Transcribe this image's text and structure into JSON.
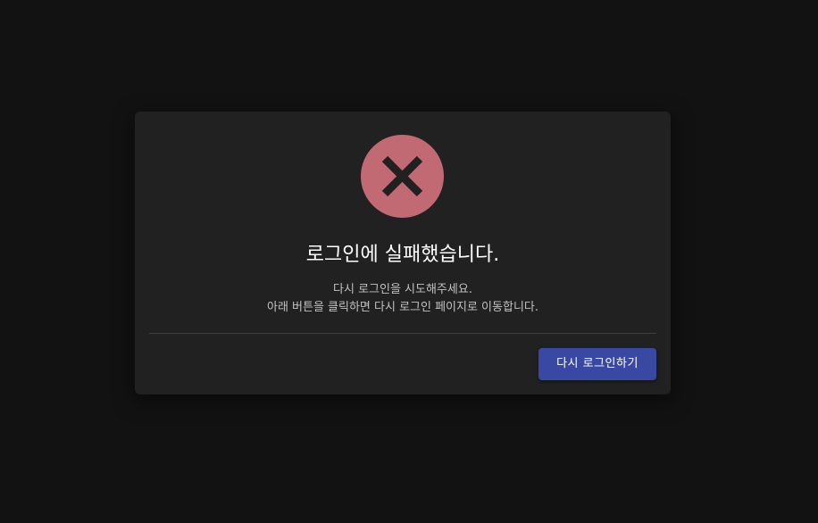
{
  "dialog": {
    "icon": "error-x-icon",
    "title": "로그인에 실패했습니다.",
    "message_lines": [
      "다시 로그인을 시도해주세요.",
      "아래 버튼을 클릭하면 다시 로그인 페이지로 이동합니다."
    ],
    "button_label": "다시 로그인하기"
  },
  "colors": {
    "background": "#121212",
    "dialog": "#212121",
    "icon_circle": "#c26a74",
    "icon_mark": "#212121",
    "button": "#3949a3",
    "title_text": "#ffffff",
    "message_text": "#c2c2c2"
  }
}
